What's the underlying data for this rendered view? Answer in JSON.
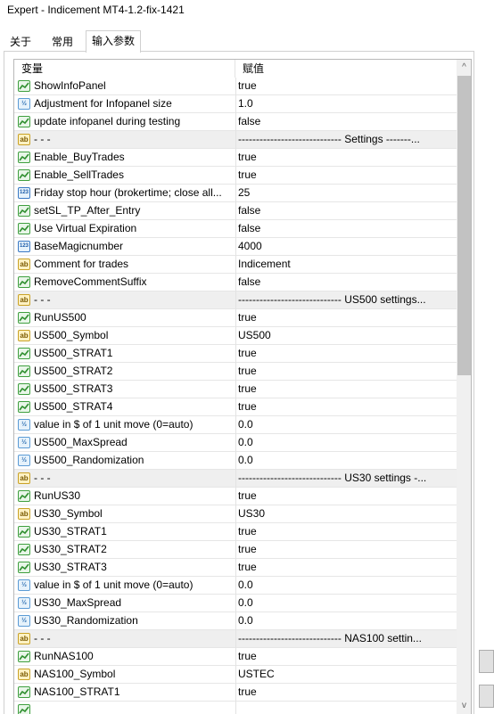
{
  "window": {
    "title": "Expert - Indicement MT4-1.2-fix-1421"
  },
  "tabs": [
    {
      "label": "关于"
    },
    {
      "label": "常用"
    },
    {
      "label": "输入参数"
    }
  ],
  "table": {
    "headers": {
      "variable": "变量",
      "value": "赋值"
    },
    "rows": [
      {
        "type": "bool",
        "icon": "boolean-icon",
        "name": "ShowInfoPanel",
        "value": "true"
      },
      {
        "type": "dbl",
        "icon": "double-icon",
        "name": "Adjustment for Infopanel size",
        "value": "1.0"
      },
      {
        "type": "bool",
        "icon": "boolean-icon",
        "name": "update infopanel during testing",
        "value": "false"
      },
      {
        "type": "str",
        "icon": "string-icon",
        "name": "- - -",
        "value": "----------------------------- Settings -------..."
      },
      {
        "type": "bool",
        "icon": "boolean-icon",
        "name": "Enable_BuyTrades",
        "value": "true"
      },
      {
        "type": "bool",
        "icon": "boolean-icon",
        "name": "Enable_SellTrades",
        "value": "true"
      },
      {
        "type": "int",
        "icon": "integer-icon",
        "name": "Friday stop hour (brokertime; close all...",
        "value": "25"
      },
      {
        "type": "bool",
        "icon": "boolean-icon",
        "name": "setSL_TP_After_Entry",
        "value": "false"
      },
      {
        "type": "bool",
        "icon": "boolean-icon",
        "name": "Use Virtual Expiration",
        "value": "false"
      },
      {
        "type": "int",
        "icon": "integer-icon",
        "name": "BaseMagicnumber",
        "value": "4000"
      },
      {
        "type": "str",
        "icon": "string-icon",
        "name": "Comment for trades",
        "value": "Indicement"
      },
      {
        "type": "bool",
        "icon": "boolean-icon",
        "name": "RemoveCommentSuffix",
        "value": "false"
      },
      {
        "type": "str",
        "icon": "string-icon",
        "name": "- - -",
        "value": "----------------------------- US500 settings..."
      },
      {
        "type": "bool",
        "icon": "boolean-icon",
        "name": "RunUS500",
        "value": "true"
      },
      {
        "type": "str",
        "icon": "string-icon",
        "name": "US500_Symbol",
        "value": "US500"
      },
      {
        "type": "bool",
        "icon": "boolean-icon",
        "name": "US500_STRAT1",
        "value": "true"
      },
      {
        "type": "bool",
        "icon": "boolean-icon",
        "name": "US500_STRAT2",
        "value": "true"
      },
      {
        "type": "bool",
        "icon": "boolean-icon",
        "name": "US500_STRAT3",
        "value": "true"
      },
      {
        "type": "bool",
        "icon": "boolean-icon",
        "name": "US500_STRAT4",
        "value": "true"
      },
      {
        "type": "dbl",
        "icon": "double-icon",
        "name": "value in $ of 1 unit move (0=auto)",
        "value": "0.0"
      },
      {
        "type": "dbl",
        "icon": "double-icon",
        "name": "US500_MaxSpread",
        "value": "0.0"
      },
      {
        "type": "dbl",
        "icon": "double-icon",
        "name": "US500_Randomization",
        "value": "0.0"
      },
      {
        "type": "str",
        "icon": "string-icon",
        "name": "- - -",
        "value": "----------------------------- US30 settings -..."
      },
      {
        "type": "bool",
        "icon": "boolean-icon",
        "name": "RunUS30",
        "value": "true"
      },
      {
        "type": "str",
        "icon": "string-icon",
        "name": "US30_Symbol",
        "value": "US30"
      },
      {
        "type": "bool",
        "icon": "boolean-icon",
        "name": "US30_STRAT1",
        "value": "true"
      },
      {
        "type": "bool",
        "icon": "boolean-icon",
        "name": "US30_STRAT2",
        "value": "true"
      },
      {
        "type": "bool",
        "icon": "boolean-icon",
        "name": "US30_STRAT3",
        "value": "true"
      },
      {
        "type": "dbl",
        "icon": "double-icon",
        "name": "value in $ of 1 unit move (0=auto)",
        "value": "0.0"
      },
      {
        "type": "dbl",
        "icon": "double-icon",
        "name": "US30_MaxSpread",
        "value": "0.0"
      },
      {
        "type": "dbl",
        "icon": "double-icon",
        "name": "US30_Randomization",
        "value": "0.0"
      },
      {
        "type": "str",
        "icon": "string-icon",
        "name": "- - -",
        "value": "----------------------------- NAS100 settin..."
      },
      {
        "type": "bool",
        "icon": "boolean-icon",
        "name": "RunNAS100",
        "value": "true"
      },
      {
        "type": "str",
        "icon": "string-icon",
        "name": "NAS100_Symbol",
        "value": "USTEC"
      },
      {
        "type": "bool",
        "icon": "boolean-icon",
        "name": "NAS100_STRAT1",
        "value": "true"
      },
      {
        "type": "bool",
        "icon": "boolean-icon",
        "name": "",
        "value": ""
      }
    ]
  },
  "scrollbar": {
    "up_glyph": "^",
    "down_glyph": "v"
  },
  "colors": {
    "row_alt": "#efefef",
    "row_plain": "#ffffff",
    "border": "#d0d0d0"
  }
}
